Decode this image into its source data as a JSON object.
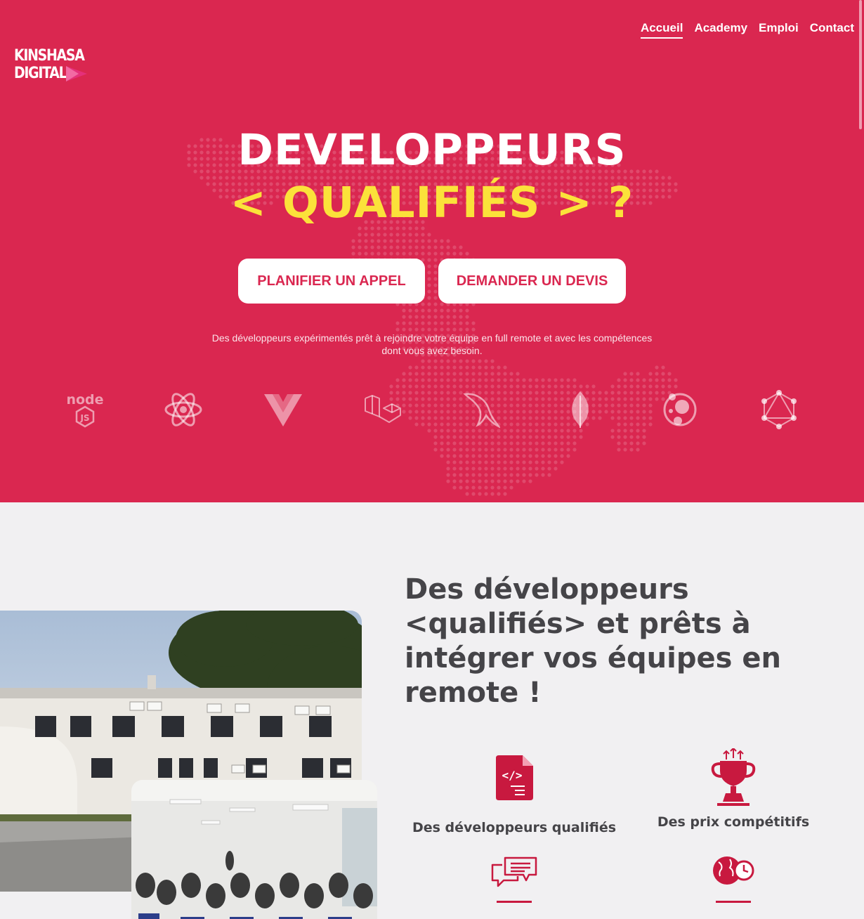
{
  "brand": {
    "line1": "KINSHASA",
    "line2": "DIGITAL",
    "accent": "#e5307a"
  },
  "nav": {
    "items": [
      {
        "label": "Accueil",
        "active": true
      },
      {
        "label": "Academy",
        "active": false
      },
      {
        "label": "Emploi",
        "active": false
      },
      {
        "label": "Contact",
        "active": false
      }
    ]
  },
  "hero": {
    "title_line1": "DEVELOPPEURS",
    "title_line2": "< QUALIFIÉS > ?",
    "button_call": "PLANIFIER UN APPEL",
    "button_quote": "DEMANDER UN DEVIS",
    "subtitle": "Des développeurs expérimentés prêt à rejoindre votre équipe en full remote et avec les compétences dont vous avez besoin.",
    "tech_icons": [
      "nodejs-icon",
      "react-icon",
      "vue-icon",
      "laravel-icon",
      "mysql-icon",
      "mongodb-icon",
      "ember-icon",
      "graphql-icon"
    ]
  },
  "section": {
    "title": "Des développeurs <qualifiés> et prêts à intégrer vos équipes en remote !",
    "features": [
      {
        "label": "Des développeurs qualifiés",
        "icon": "code-file-icon"
      },
      {
        "label": "Des prix compétitifs",
        "icon": "trophy-icon"
      },
      {
        "label": "",
        "icon": "chat-bubbles-icon"
      },
      {
        "label": "",
        "icon": "globe-clock-icon"
      }
    ]
  },
  "colors": {
    "primary": "#da2750",
    "highlight": "#fbe23a",
    "background": "#f1f0f2",
    "text": "#454448",
    "feature_icon": "#c8193f"
  }
}
